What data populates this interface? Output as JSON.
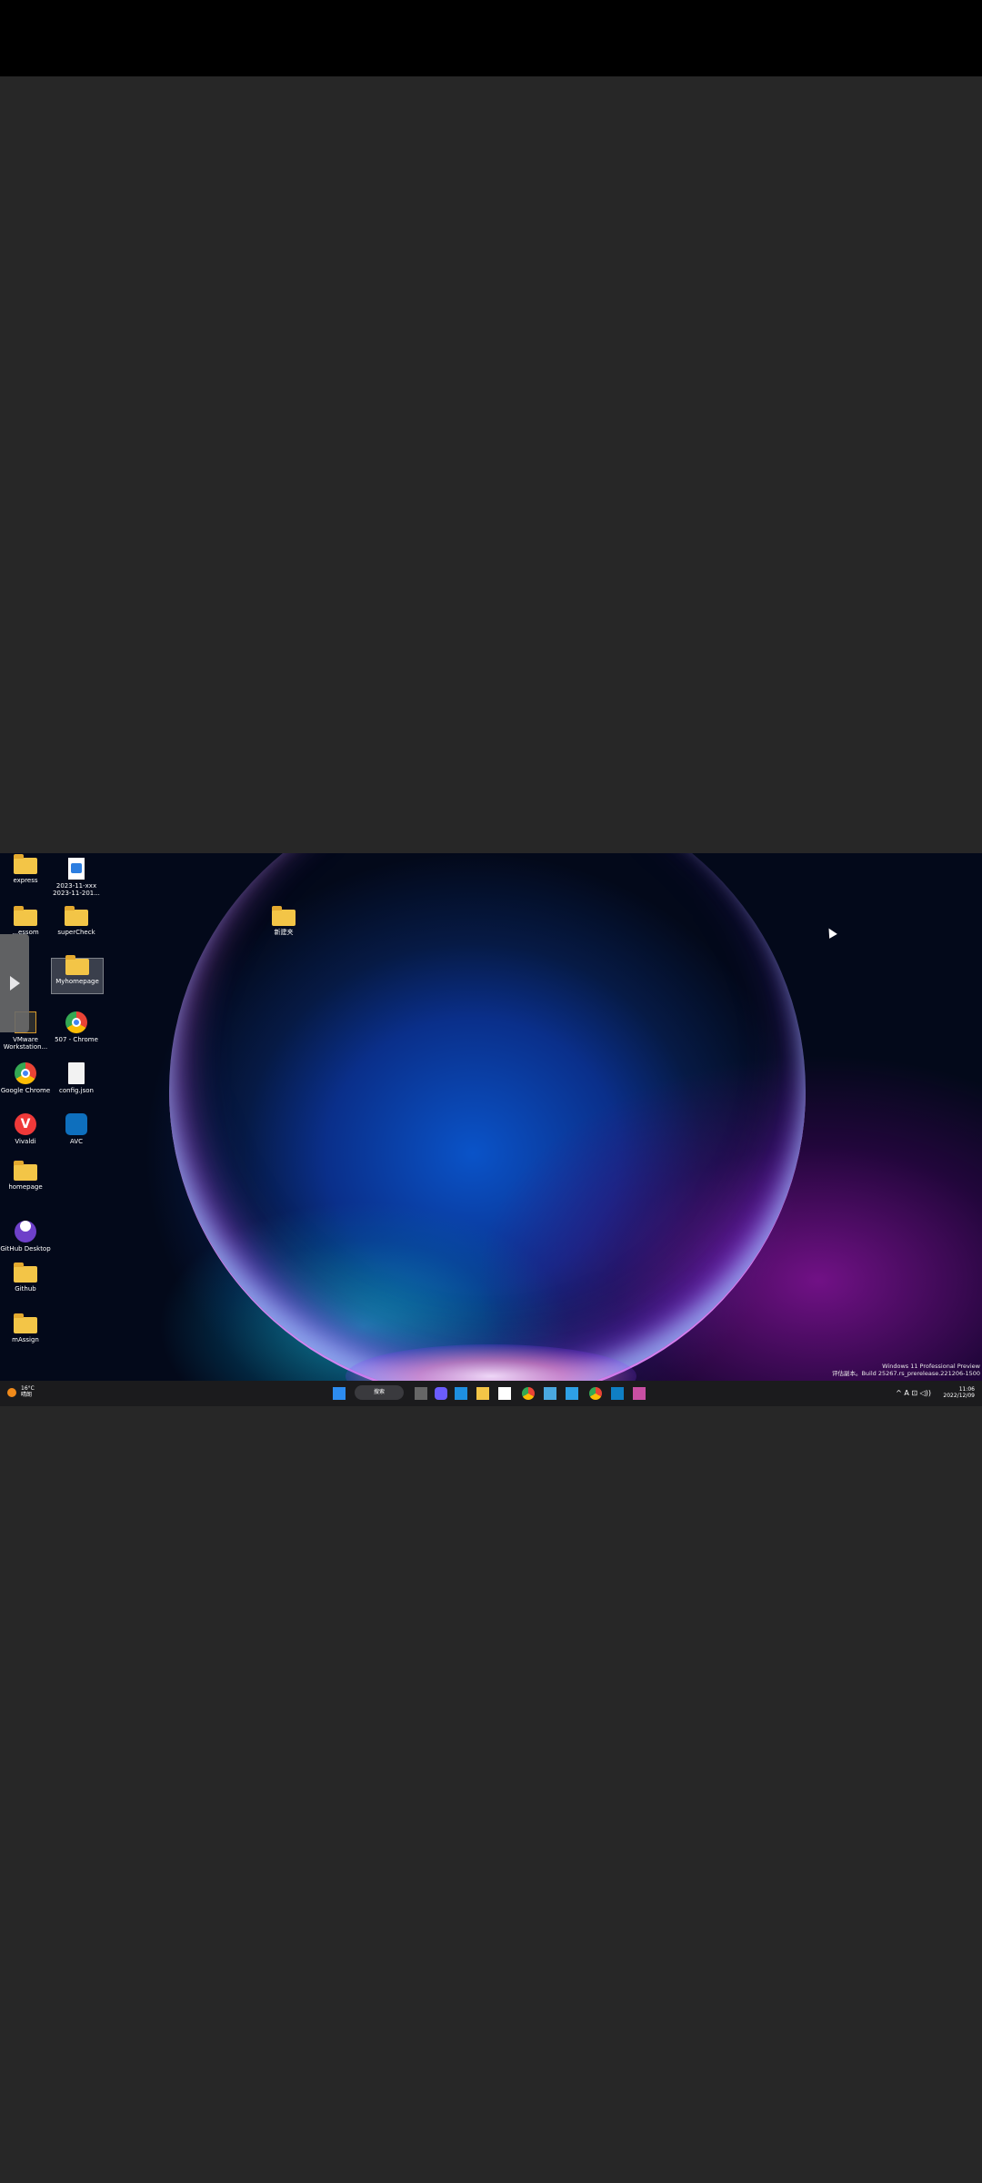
{
  "desktop": {
    "icons": [
      {
        "label": "express"
      },
      {
        "label": "2023-11-xxx 2023-11-201..."
      },
      {
        "label": "...essom"
      },
      {
        "label": "superCheck"
      },
      {
        "label": "Myhomepage"
      },
      {
        "label": "VMware Workstation..."
      },
      {
        "label": "507 - Chrome"
      },
      {
        "label": "Google Chrome"
      },
      {
        "label": "config.json"
      },
      {
        "label": "Vivaldi"
      },
      {
        "label": "AVC"
      },
      {
        "label": "homepage"
      },
      {
        "label": "GitHub Desktop"
      },
      {
        "label": "Github"
      },
      {
        "label": "mAssign"
      },
      {
        "label": "新建夹"
      }
    ]
  },
  "watermark": {
    "line1": "Windows 11 Professional Preview",
    "line2": "评估副本。Build 25267.rs_prerelease.221206-1500"
  },
  "taskbar": {
    "weather_temp": "16°C",
    "weather_desc": "晴朗",
    "search_label": "搜索",
    "tray_glyphs": "^  A  ⊡  ◁))",
    "time": "11:06",
    "date": "2022/12/09"
  },
  "colors": {
    "folder": "#f3c547",
    "accent": "#2d8cf0",
    "taskbar": "#1b1b1d"
  }
}
